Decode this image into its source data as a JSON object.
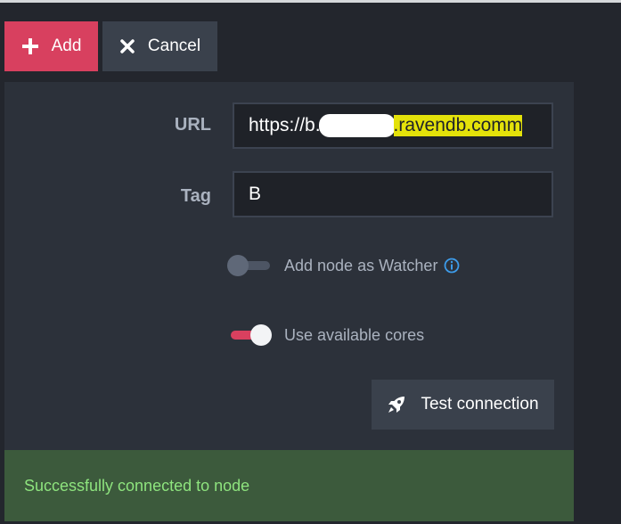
{
  "toolbar": {
    "add_label": "Add",
    "cancel_label": "Cancel"
  },
  "form": {
    "url_label": "URL",
    "url_value_prefix": "https://b.",
    "url_value_suffix": ".ravendb.comm",
    "tag_label": "Tag",
    "tag_value": "B",
    "watcher_label": "Add node as Watcher",
    "watcher_enabled": false,
    "cores_label": "Use available cores",
    "cores_enabled": true,
    "test_button_label": "Test connection"
  },
  "status": {
    "message": "Successfully connected to node"
  },
  "colors": {
    "accent": "#d8405f",
    "success_bg": "#3c5a3c",
    "success_text": "#8ee47e",
    "info": "#3d9be9"
  },
  "icons": {
    "add": "plus-icon",
    "cancel": "close-icon",
    "watcher_info": "info-icon",
    "test": "rocket-icon"
  }
}
